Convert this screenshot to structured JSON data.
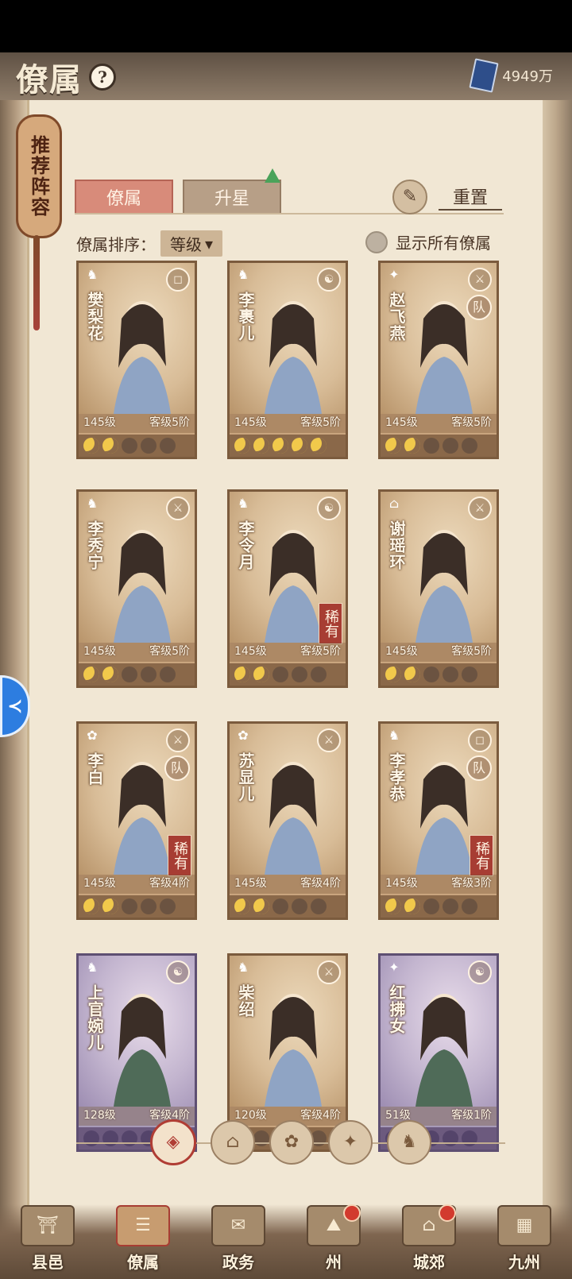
{
  "header": {
    "title": "僚属",
    "help_icon": "?",
    "currency_value": "4949万",
    "currency_icon": "blue-book-icon"
  },
  "recommend_label": "推荐阵容",
  "tabs": [
    {
      "label": "僚属",
      "active": true
    },
    {
      "label": "升星",
      "active": false
    }
  ],
  "reset_label": "重置",
  "sort": {
    "label": "僚属排序：",
    "selected": "等级",
    "arrow": "▾"
  },
  "show_all_label": "显示所有僚属",
  "badges": {
    "rare": "稀有",
    "team": "队"
  },
  "cards": [
    {
      "name": "樊梨花",
      "level": "145级",
      "rank": "客级5阶",
      "moons": 2,
      "purple": false,
      "rare": false,
      "team": false,
      "class_icon": "♞",
      "type_icon": "◻"
    },
    {
      "name": "李裹儿",
      "level": "145级",
      "rank": "客级5阶",
      "moons": 5,
      "purple": false,
      "rare": false,
      "team": false,
      "class_icon": "♞",
      "type_icon": "☯"
    },
    {
      "name": "赵飞燕",
      "level": "145级",
      "rank": "客级5阶",
      "moons": 2,
      "purple": false,
      "rare": false,
      "team": true,
      "class_icon": "✦",
      "type_icon": "⚔"
    },
    {
      "name": "李秀宁",
      "level": "145级",
      "rank": "客级5阶",
      "moons": 2,
      "purple": false,
      "rare": false,
      "team": false,
      "class_icon": "♞",
      "type_icon": "⚔"
    },
    {
      "name": "李令月",
      "level": "145级",
      "rank": "客级5阶",
      "moons": 2,
      "purple": false,
      "rare": true,
      "team": false,
      "class_icon": "♞",
      "type_icon": "☯"
    },
    {
      "name": "谢瑶环",
      "level": "145级",
      "rank": "客级5阶",
      "moons": 2,
      "purple": false,
      "rare": false,
      "team": false,
      "class_icon": "⌂",
      "type_icon": "⚔"
    },
    {
      "name": "李白",
      "level": "145级",
      "rank": "客级4阶",
      "moons": 2,
      "purple": false,
      "rare": true,
      "team": true,
      "class_icon": "✿",
      "type_icon": "⚔"
    },
    {
      "name": "苏显儿",
      "level": "145级",
      "rank": "客级4阶",
      "moons": 2,
      "purple": false,
      "rare": false,
      "team": false,
      "class_icon": "✿",
      "type_icon": "⚔"
    },
    {
      "name": "李孝恭",
      "level": "145级",
      "rank": "客级3阶",
      "moons": 2,
      "purple": false,
      "rare": true,
      "team": true,
      "class_icon": "♞",
      "type_icon": "◻"
    },
    {
      "name": "上官婉儿",
      "level": "128级",
      "rank": "客级4阶",
      "moons": 0,
      "purple": true,
      "rare": false,
      "team": false,
      "class_icon": "♞",
      "type_icon": "☯"
    },
    {
      "name": "柴绍",
      "level": "120级",
      "rank": "客级4阶",
      "moons": 0,
      "purple": false,
      "rare": false,
      "team": false,
      "class_icon": "♞",
      "type_icon": "⚔"
    },
    {
      "name": "红拂女",
      "level": "51级",
      "rank": "客级1阶",
      "moons": 0,
      "purple": true,
      "rare": false,
      "team": false,
      "class_icon": "✦",
      "type_icon": "☯"
    }
  ],
  "filters": [
    {
      "icon": "all-filter-icon",
      "glyph": "◈",
      "active": true
    },
    {
      "icon": "bell-filter-icon",
      "glyph": "⌂",
      "active": false
    },
    {
      "icon": "cloud-filter-icon",
      "glyph": "✿",
      "active": false
    },
    {
      "icon": "fan-filter-icon",
      "glyph": "✦",
      "active": false
    },
    {
      "icon": "horse-filter-icon",
      "glyph": "♞",
      "active": false
    }
  ],
  "nav": [
    {
      "label": "县邑",
      "icon": "city-gate-icon",
      "glyph": "⛩",
      "active": false,
      "dot": false
    },
    {
      "label": "僚属",
      "icon": "scroll-cards-icon",
      "glyph": "☰",
      "active": true,
      "dot": false
    },
    {
      "label": "政务",
      "icon": "documents-icon",
      "glyph": "✉",
      "active": false,
      "dot": false
    },
    {
      "label": "州",
      "icon": "mountain-icon",
      "glyph": "⛰",
      "active": false,
      "dot": true
    },
    {
      "label": "城郊",
      "icon": "countryside-icon",
      "glyph": "⌂",
      "active": false,
      "dot": true
    },
    {
      "label": "九州",
      "icon": "map-icon",
      "glyph": "▦",
      "active": false,
      "dot": false
    }
  ],
  "assist_icon": "assist-icon"
}
